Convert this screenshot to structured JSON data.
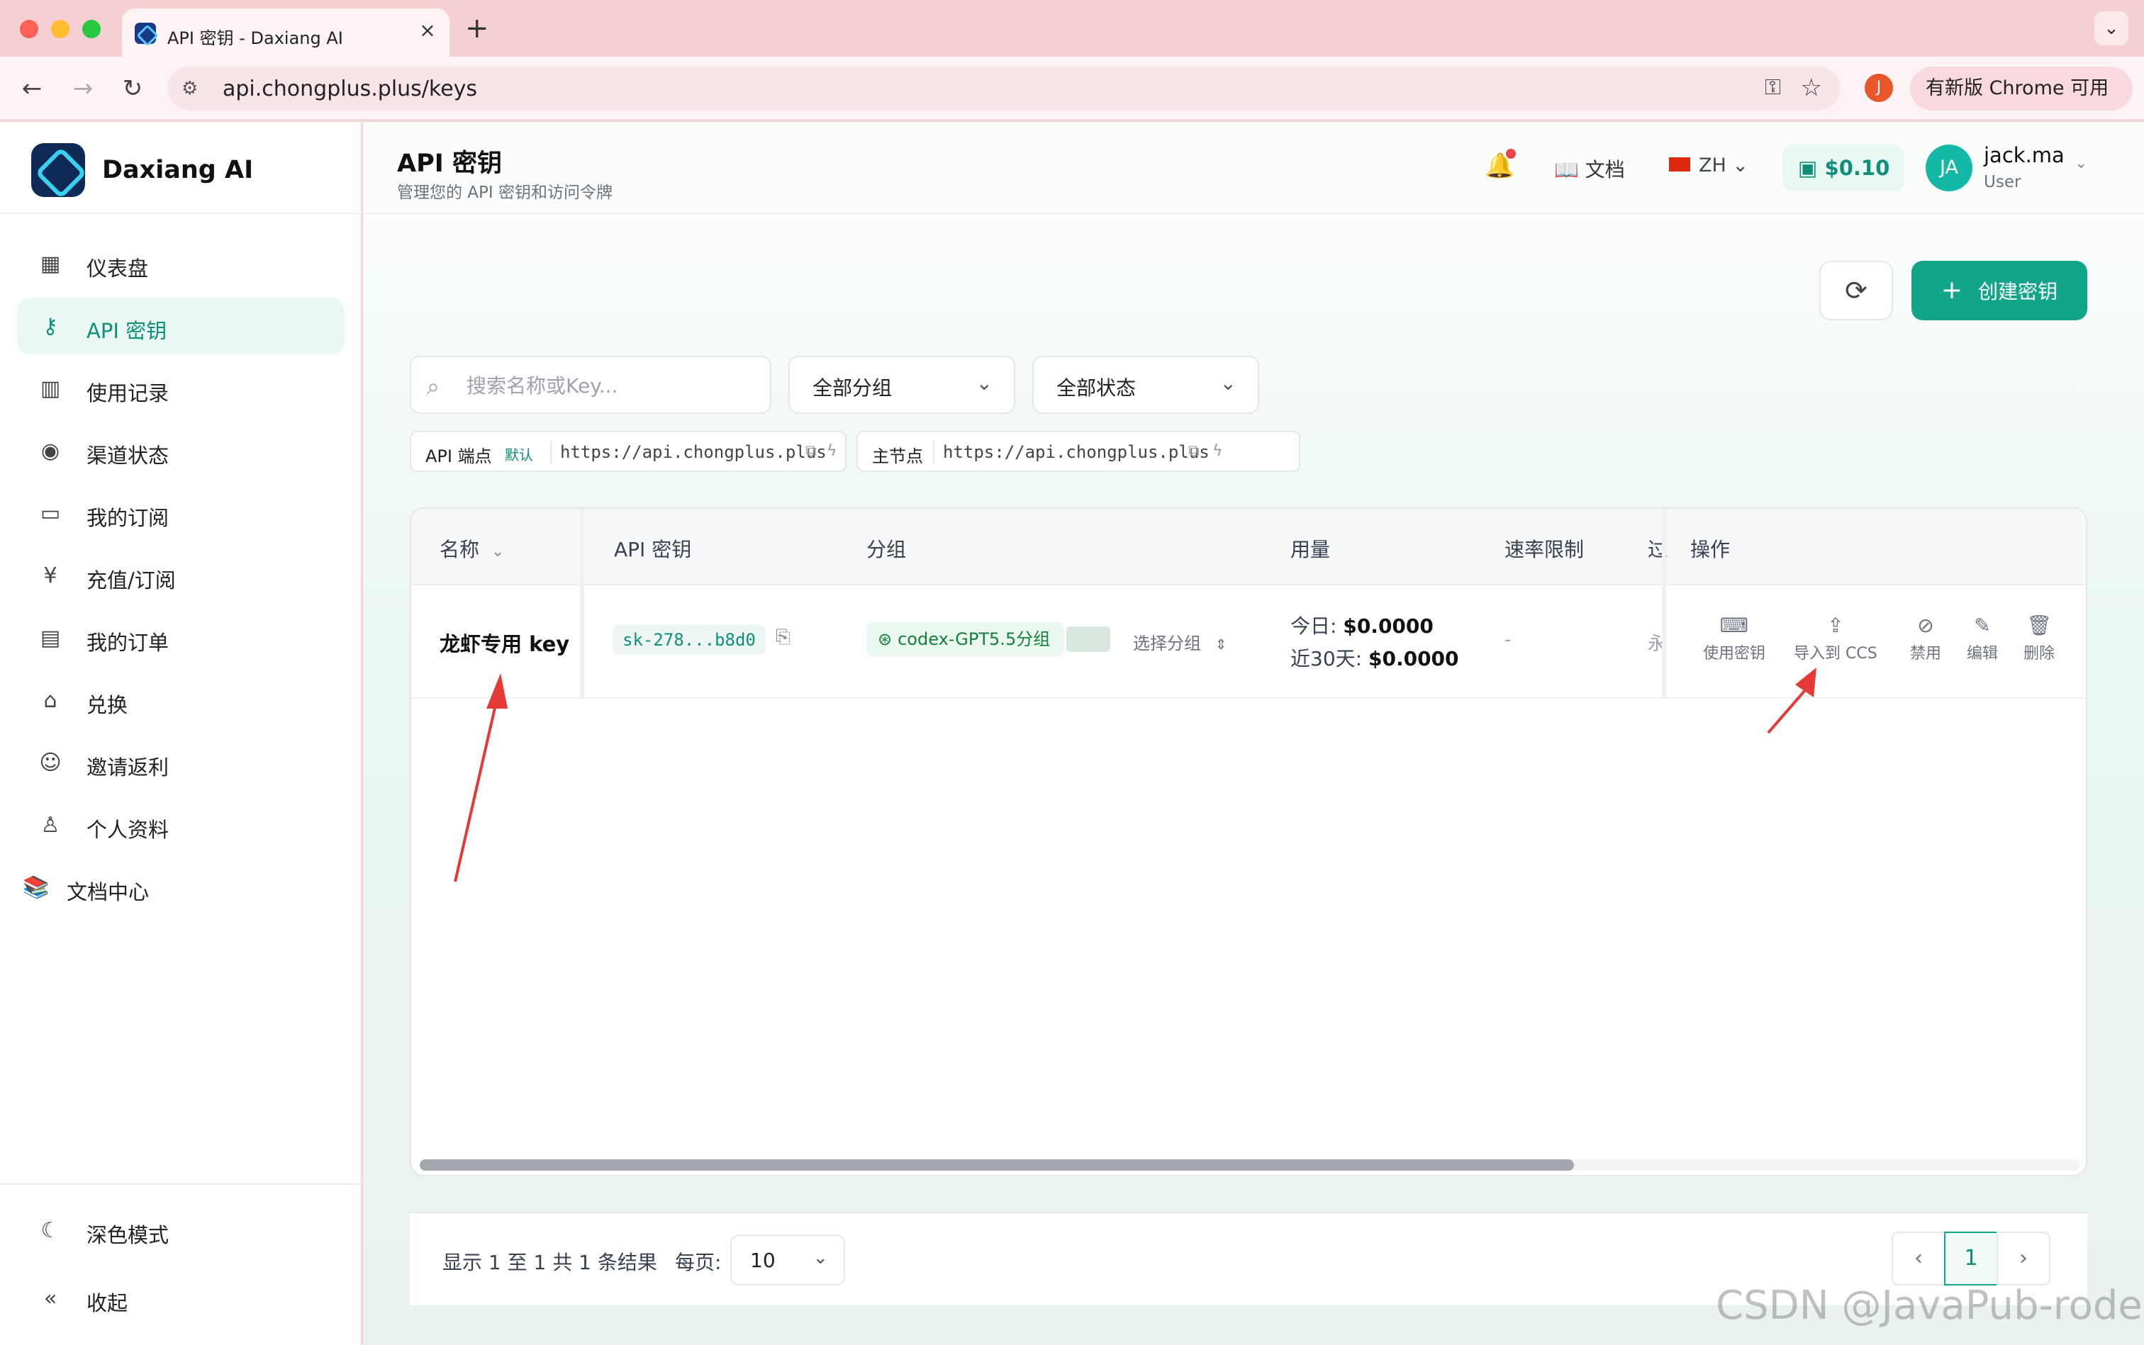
{
  "browser": {
    "tab_title": "API 密钥 - Daxiang AI",
    "tab_close": "×",
    "new_tab": "+",
    "tab_dropdown": "⌄",
    "url": "api.chongplus.plus/keys",
    "profile_initial": "J",
    "update_label": "有新版 Chrome 可用",
    "nav": {
      "back": "←",
      "forward": "→",
      "reload": "↻"
    },
    "omni_icons": {
      "site_info": "⚙",
      "key": "⚿",
      "star": "☆"
    }
  },
  "sidebar": {
    "brand": "Daxiang AI",
    "items": [
      {
        "label": "仪表盘",
        "icon": "▦",
        "icon_name": "dashboard-icon"
      },
      {
        "label": "API 密钥",
        "icon": "⚷",
        "icon_name": "key-icon",
        "active": true
      },
      {
        "label": "使用记录",
        "icon": "▥",
        "icon_name": "bar-chart-icon"
      },
      {
        "label": "渠道状态",
        "icon": "◉",
        "icon_name": "signal-icon"
      },
      {
        "label": "我的订阅",
        "icon": "▭",
        "icon_name": "card-icon"
      },
      {
        "label": "充值/订阅",
        "icon": "¥",
        "icon_name": "yen-icon"
      },
      {
        "label": "我的订单",
        "icon": "▤",
        "icon_name": "document-icon"
      },
      {
        "label": "兑换",
        "icon": "⌂",
        "icon_name": "gift-icon"
      },
      {
        "label": "邀请返利",
        "icon": "☺",
        "icon_name": "users-icon"
      },
      {
        "label": "个人资料",
        "icon": "♙",
        "icon_name": "user-icon"
      },
      {
        "label": "文档中心",
        "icon": "📚",
        "icon_name": "books-icon"
      }
    ],
    "dark_mode": {
      "label": "深色模式",
      "icon": "☾"
    },
    "collapse": {
      "label": "收起",
      "icon": "«"
    }
  },
  "header": {
    "title": "API 密钥",
    "subtitle": "管理您的 API 密钥和访问令牌",
    "bell_icon": "🔔",
    "docs_label": "文档",
    "docs_icon": "📖",
    "lang": "ZH",
    "lang_chevron": "⌄",
    "balance": "$0.10",
    "balance_icon": "▣",
    "avatar_initials": "JA",
    "user_name": "jack.ma",
    "user_role": "User",
    "user_chevron": "⌄"
  },
  "actions": {
    "refresh_icon": "⟳",
    "create_label": "创建密钥",
    "create_icon": "+"
  },
  "filters": {
    "search_placeholder": "搜索名称或Key...",
    "search_icon": "⌕",
    "group_select": "全部分组",
    "status_select": "全部状态",
    "chevron": "⌄"
  },
  "endpoints": [
    {
      "label": "API 端点",
      "badge": "默认",
      "url": "https://api.chongplus.plus"
    },
    {
      "label": "主节点",
      "badge": "",
      "url": "https://api.chongplus.plus"
    }
  ],
  "endpoint_icons": {
    "copy": "⧉",
    "bolt": "ϟ"
  },
  "table": {
    "columns": [
      "名称",
      "API 密钥",
      "分组",
      "用量",
      "速率限制",
      "过",
      "操作"
    ],
    "name_sort_icon": "⌄",
    "rows": [
      {
        "name": "龙虾专用 key",
        "key": "sk-278...b8d0",
        "copy_icon": "⎘",
        "group": "codex-GPT5.5分组",
        "group_icon": "⊛",
        "group_select": "选择分组",
        "group_select_icon": "⇕",
        "usage_today_label": "今日:",
        "usage_today": "$0.0000",
        "usage_30d_label": "近30天:",
        "usage_30d": "$0.0000",
        "rate_limit": "-",
        "expire": "永",
        "actions": [
          {
            "label": "使用密钥",
            "icon": "⌨"
          },
          {
            "label": "导入到 CCS",
            "icon": "⇪"
          },
          {
            "label": "禁用",
            "icon": "⊘"
          },
          {
            "label": "编辑",
            "icon": "✎"
          },
          {
            "label": "删除",
            "icon": "🗑"
          }
        ]
      }
    ]
  },
  "pagination": {
    "summary": "显示 1 至 1 共 1 条结果",
    "per_page_label": "每页:",
    "per_page": "10",
    "per_page_chevron": "⌄",
    "prev": "‹",
    "current": "1",
    "next": "›"
  },
  "watermark": "CSDN @JavaPub-rodert",
  "colors": {
    "accent": "#12a58c",
    "arrow": "#e53935"
  }
}
